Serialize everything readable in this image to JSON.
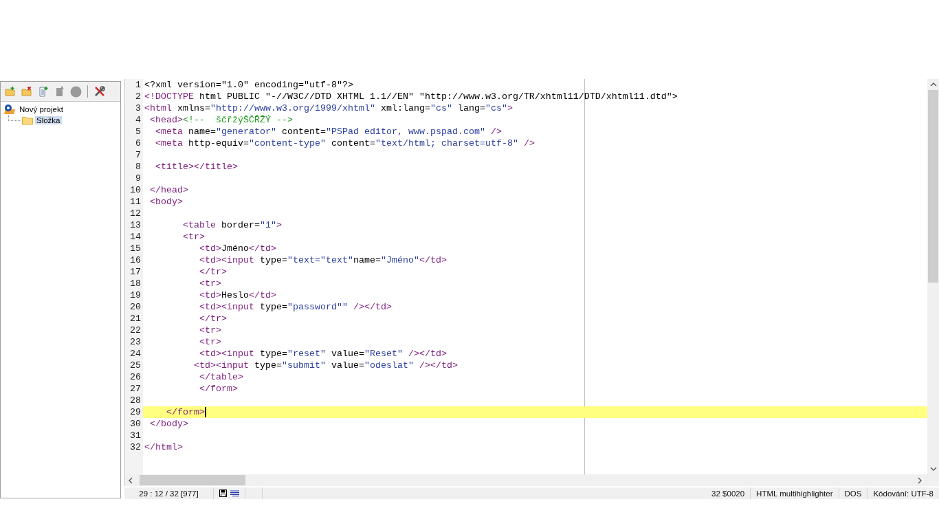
{
  "project_panel": {
    "toolbar": [
      {
        "kind": "new-folder",
        "disabled": false
      },
      {
        "kind": "delete-folder",
        "disabled": false
      },
      {
        "kind": "new-file",
        "disabled": false
      },
      {
        "kind": "file",
        "disabled": true
      },
      {
        "kind": "circle",
        "disabled": true
      },
      {
        "kind": "tools",
        "disabled": false
      }
    ],
    "tree": [
      {
        "label": "Nový projekt",
        "kind": "project",
        "selected": false,
        "children": [
          {
            "label": "Složka",
            "kind": "folder",
            "selected": true
          }
        ]
      }
    ]
  },
  "editor": {
    "lines": [
      {
        "number": "1",
        "current": false,
        "tokens": [
          {
            "kind": "text",
            "text": "<?xml version=\"1.0\" encoding=\"utf-8\"?>"
          }
        ]
      },
      {
        "number": "2",
        "current": false,
        "tokens": [
          {
            "kind": "tag",
            "text": "<!DOCTYPE"
          },
          {
            "kind": "text",
            "text": " html PUBLIC \"-//W3C//DTD XHTML 1.1//EN\" \"http://www.w3.org/TR/xhtml11/DTD/xhtml11.dtd\">"
          }
        ]
      },
      {
        "number": "3",
        "current": false,
        "tokens": [
          {
            "kind": "tag",
            "text": "<html"
          },
          {
            "kind": "attr",
            "text": " xmlns="
          },
          {
            "kind": "str",
            "text": "\"http://www.w3.org/1999/xhtml\""
          },
          {
            "kind": "attr",
            "text": " xml:lang="
          },
          {
            "kind": "str",
            "text": "\"cs\""
          },
          {
            "kind": "attr",
            "text": " lang="
          },
          {
            "kind": "str",
            "text": "\"cs\""
          },
          {
            "kind": "tag",
            "text": ">"
          }
        ]
      },
      {
        "number": "4",
        "current": false,
        "tokens": [
          {
            "kind": "tag",
            "text": " <head>"
          },
          {
            "kind": "comment",
            "text": "<!--  ščřžýŠČŘŽÝ -->"
          }
        ]
      },
      {
        "number": "5",
        "current": false,
        "tokens": [
          {
            "kind": "tag",
            "text": "  <meta"
          },
          {
            "kind": "attr",
            "text": " name="
          },
          {
            "kind": "str",
            "text": "\"generator\""
          },
          {
            "kind": "attr",
            "text": " content="
          },
          {
            "kind": "str",
            "text": "\"PSPad editor, www.pspad.com\""
          },
          {
            "kind": "tag",
            "text": " />"
          }
        ]
      },
      {
        "number": "6",
        "current": false,
        "tokens": [
          {
            "kind": "tag",
            "text": "  <meta"
          },
          {
            "kind": "attr",
            "text": " http-equiv="
          },
          {
            "kind": "str",
            "text": "\"content-type\""
          },
          {
            "kind": "attr",
            "text": " content="
          },
          {
            "kind": "str",
            "text": "\"text/html; charset=utf-8\""
          },
          {
            "kind": "tag",
            "text": " />"
          }
        ]
      },
      {
        "number": "7",
        "current": false
      },
      {
        "number": "8",
        "current": false,
        "tokens": [
          {
            "kind": "tag",
            "text": "  <title></title>"
          }
        ]
      },
      {
        "number": "9",
        "current": false
      },
      {
        "number": "10",
        "current": false,
        "tokens": [
          {
            "kind": "tag",
            "text": " </head>"
          }
        ]
      },
      {
        "number": "11",
        "current": false,
        "tokens": [
          {
            "kind": "tag",
            "text": " <body>"
          }
        ]
      },
      {
        "number": "12",
        "current": false
      },
      {
        "number": "13",
        "current": false,
        "tokens": [
          {
            "kind": "tag",
            "text": "       <table"
          },
          {
            "kind": "attr",
            "text": " border="
          },
          {
            "kind": "str",
            "text": "\"1\""
          },
          {
            "kind": "tag",
            "text": ">"
          }
        ]
      },
      {
        "number": "14",
        "current": false,
        "tokens": [
          {
            "kind": "tag",
            "text": "       <tr>"
          }
        ]
      },
      {
        "number": "15",
        "current": false,
        "tokens": [
          {
            "kind": "tag",
            "text": "          <td>"
          },
          {
            "kind": "text",
            "text": "Jméno"
          },
          {
            "kind": "tag",
            "text": "</td>"
          }
        ]
      },
      {
        "number": "16",
        "current": false,
        "tokens": [
          {
            "kind": "tag",
            "text": "          <td><input"
          },
          {
            "kind": "attr",
            "text": " type="
          },
          {
            "kind": "str",
            "text": "\"text=\"text\""
          },
          {
            "kind": "attr",
            "text": "name="
          },
          {
            "kind": "str",
            "text": "\"Jméno\""
          },
          {
            "kind": "tag",
            "text": "</td>"
          }
        ]
      },
      {
        "number": "17",
        "current": false,
        "tokens": [
          {
            "kind": "tag",
            "text": "          </tr>"
          }
        ]
      },
      {
        "number": "18",
        "current": false,
        "tokens": [
          {
            "kind": "tag",
            "text": "          <tr>"
          }
        ]
      },
      {
        "number": "19",
        "current": false,
        "tokens": [
          {
            "kind": "tag",
            "text": "          <td>"
          },
          {
            "kind": "text",
            "text": "Heslo"
          },
          {
            "kind": "tag",
            "text": "</td>"
          }
        ]
      },
      {
        "number": "20",
        "current": false,
        "tokens": [
          {
            "kind": "tag",
            "text": "          <td><input"
          },
          {
            "kind": "attr",
            "text": " type="
          },
          {
            "kind": "str",
            "text": "\"password\"\""
          },
          {
            "kind": "tag",
            "text": " /></td>"
          }
        ]
      },
      {
        "number": "21",
        "current": false,
        "tokens": [
          {
            "kind": "tag",
            "text": "          </tr>"
          }
        ]
      },
      {
        "number": "22",
        "current": false,
        "tokens": [
          {
            "kind": "tag",
            "text": "          <tr>"
          }
        ]
      },
      {
        "number": "23",
        "current": false,
        "tokens": [
          {
            "kind": "tag",
            "text": "          <tr>"
          }
        ]
      },
      {
        "number": "24",
        "current": false,
        "tokens": [
          {
            "kind": "tag",
            "text": "          <td><input"
          },
          {
            "kind": "attr",
            "text": " type="
          },
          {
            "kind": "str",
            "text": "\"reset\""
          },
          {
            "kind": "attr",
            "text": " value="
          },
          {
            "kind": "str",
            "text": "\"Reset\""
          },
          {
            "kind": "tag",
            "text": " /></td>"
          }
        ]
      },
      {
        "number": "25",
        "current": false,
        "tokens": [
          {
            "kind": "tag",
            "text": "         <td><input"
          },
          {
            "kind": "attr",
            "text": " type="
          },
          {
            "kind": "str",
            "text": "\"submit\""
          },
          {
            "kind": "attr",
            "text": " value="
          },
          {
            "kind": "str",
            "text": "\"odeslat\""
          },
          {
            "kind": "tag",
            "text": " /></td>"
          }
        ]
      },
      {
        "number": "26",
        "current": false,
        "tokens": [
          {
            "kind": "tag",
            "text": "          </table>"
          }
        ]
      },
      {
        "number": "27",
        "current": false,
        "tokens": [
          {
            "kind": "tag",
            "text": "          </form>"
          }
        ]
      },
      {
        "number": "28",
        "current": false
      },
      {
        "number": "29",
        "current": true,
        "tokens": [
          {
            "kind": "tag",
            "text": "    </form>"
          }
        ]
      },
      {
        "number": "30",
        "current": false,
        "tokens": [
          {
            "kind": "tag",
            "text": " </body>"
          }
        ]
      },
      {
        "number": "31",
        "current": false
      },
      {
        "number": "32",
        "current": false,
        "tokens": [
          {
            "kind": "tag",
            "text": "</html>"
          }
        ]
      }
    ]
  },
  "status_bar": {
    "position": "29 : 12 / 32  [977]",
    "char_code": "32  $0020",
    "highlighter": "HTML multihighlighter",
    "line_ending": "DOS",
    "encoding": "Kódování: UTF-8"
  }
}
